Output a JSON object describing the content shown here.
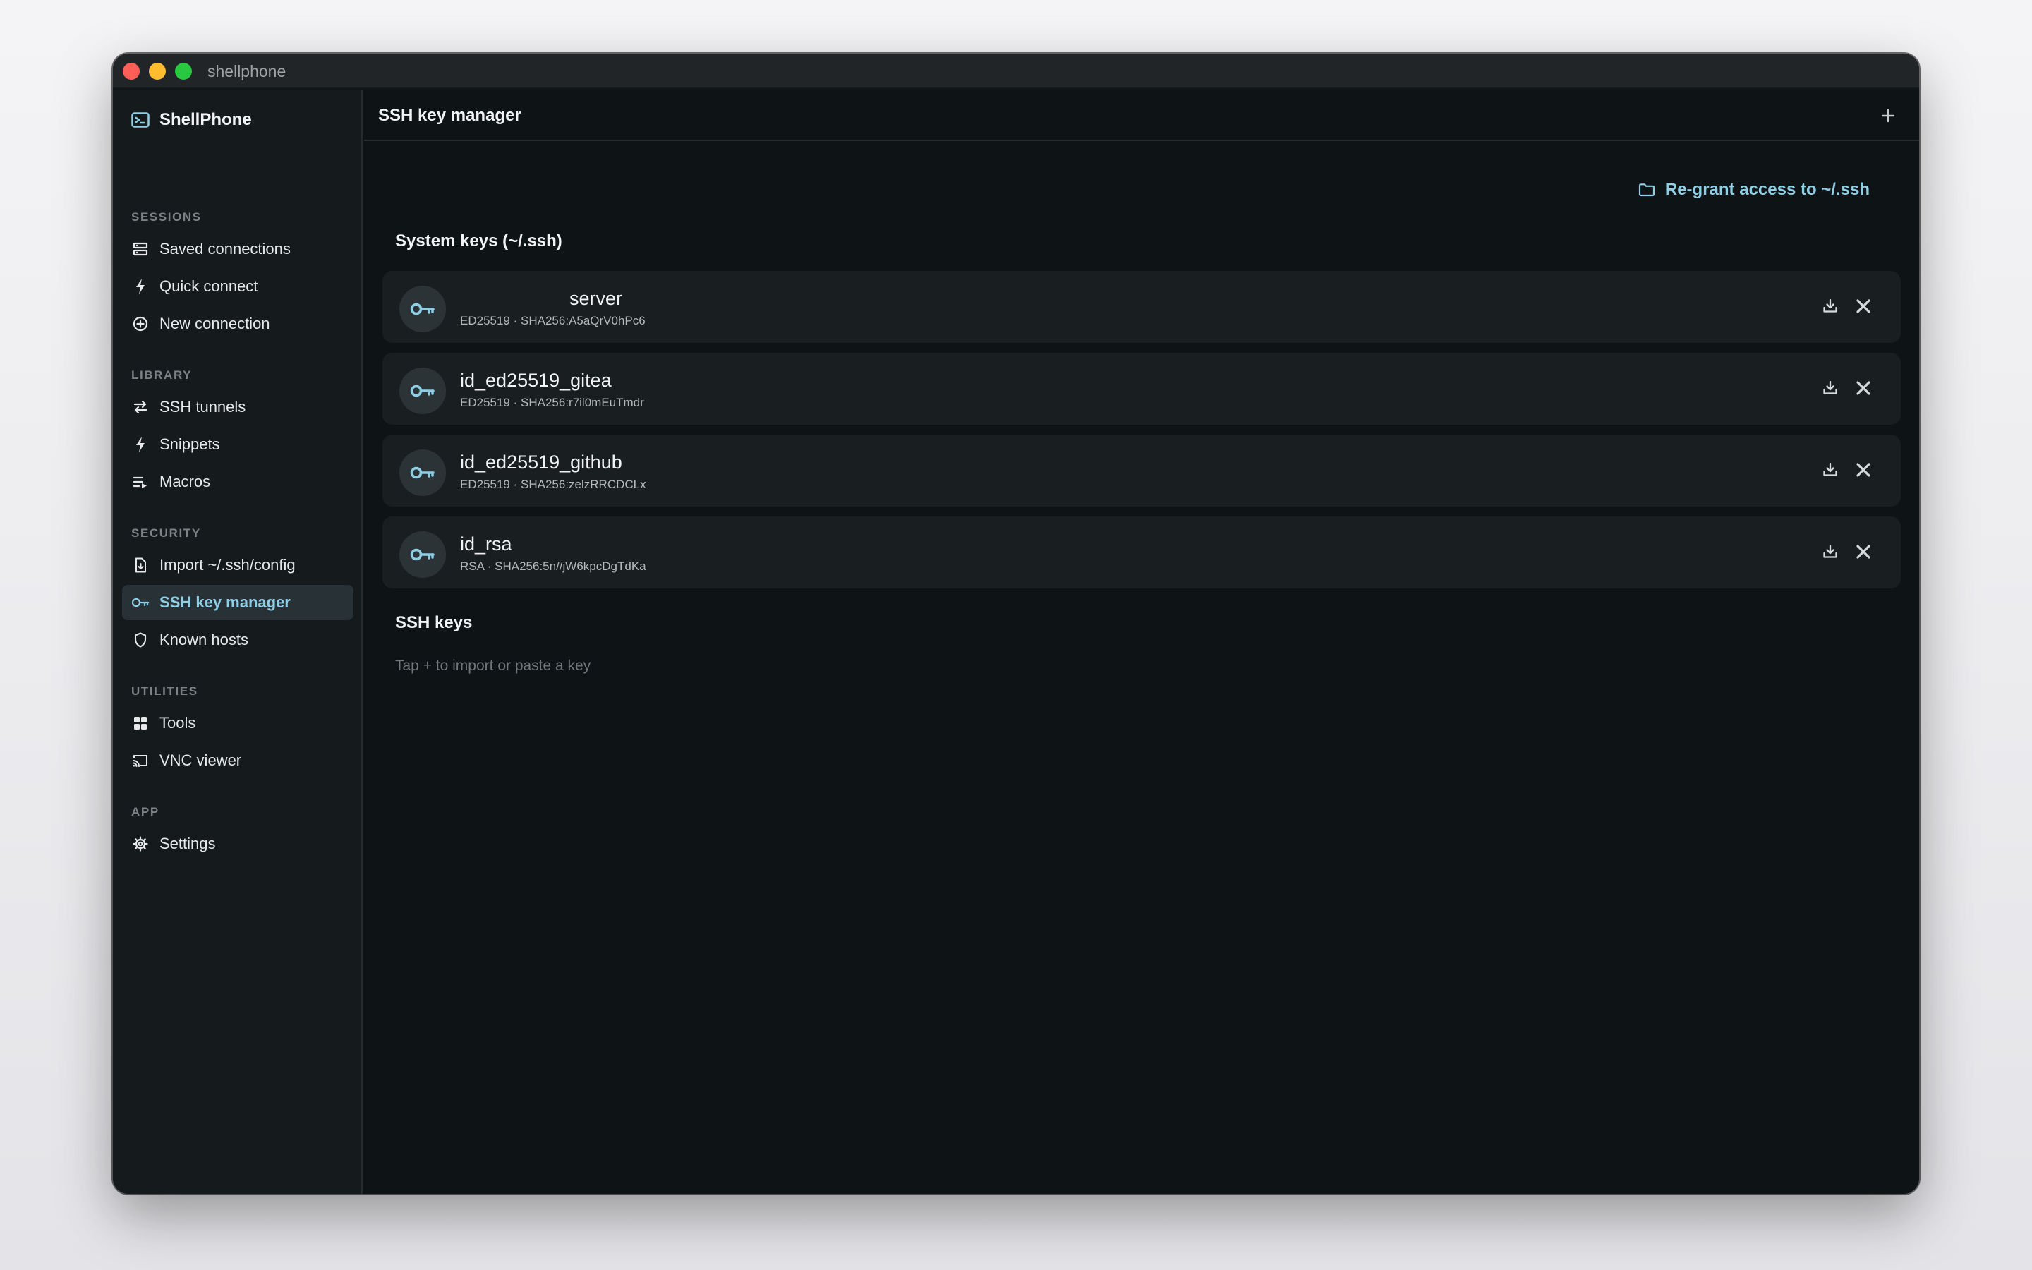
{
  "window": {
    "title": "shellphone"
  },
  "sidebar": {
    "brand": "ShellPhone",
    "sections": {
      "sessions": "SESSIONS",
      "library": "LIBRARY",
      "security": "SECURITY",
      "utilities": "UTILITIES",
      "app": "APP"
    },
    "items": {
      "saved_connections": "Saved connections",
      "quick_connect": "Quick connect",
      "new_connection": "New connection",
      "ssh_tunnels": "SSH tunnels",
      "snippets": "Snippets",
      "macros": "Macros",
      "import_config": "Import ~/.ssh/config",
      "ssh_key_manager": "SSH key manager",
      "known_hosts": "Known hosts",
      "tools": "Tools",
      "vnc_viewer": "VNC viewer",
      "settings": "Settings"
    },
    "active_item": "ssh_key_manager"
  },
  "main": {
    "title": "SSH key manager",
    "add_button_icon": "plus-icon",
    "system_keys_title": "System keys (~/.ssh)",
    "regrant_label": "Re-grant access to ~/.ssh",
    "system_keys": [
      {
        "name": "server",
        "meta": "ED25519 · SHA256:A5aQrV0hPc6"
      },
      {
        "name": "id_ed25519_gitea",
        "meta": "ED25519 · SHA256:r7il0mEuTmdr"
      },
      {
        "name": "id_ed25519_github",
        "meta": "ED25519 · SHA256:zelzRRCDCLx"
      },
      {
        "name": "id_rsa",
        "meta": "RSA · SHA256:5n//jW6kpcDgTdKa"
      }
    ],
    "ssh_keys_title": "SSH keys",
    "ssh_keys_hint": "Tap + to import or paste a key"
  },
  "colors": {
    "accent": "#8fcfe6",
    "window_bg": "#0e1315",
    "sidebar_bg": "#151a1c",
    "row_bg": "#191e20",
    "active_item_bg": "#283236"
  }
}
